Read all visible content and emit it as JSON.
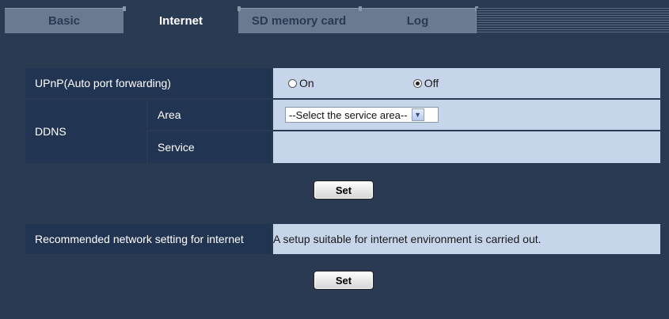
{
  "tabs": [
    {
      "label": "Basic",
      "active": false
    },
    {
      "label": "Internet",
      "active": true
    },
    {
      "label": "SD memory card",
      "active": false
    },
    {
      "label": "Log",
      "active": false
    }
  ],
  "upnp": {
    "label": "UPnP(Auto port forwarding)",
    "options": [
      {
        "label": "On",
        "checked": false
      },
      {
        "label": "Off",
        "checked": true
      }
    ]
  },
  "ddns": {
    "label": "DDNS",
    "area": {
      "label": "Area",
      "selected": "--Select the service area--"
    },
    "service": {
      "label": "Service",
      "value": ""
    }
  },
  "set_button_label": "Set",
  "recommended": {
    "label": "Recommended network setting for internet",
    "value": "A setup suitable for internet environment is carried out."
  },
  "set_button_2_label": "Set",
  "colors": {
    "background": "#2a3a52",
    "label_cell": "#213451",
    "value_cell": "#c6d5ea",
    "inactive_tab": "#6a7a90"
  },
  "icons": {
    "radio": "radio-circle",
    "select_arrow": "chevron-down-icon"
  }
}
